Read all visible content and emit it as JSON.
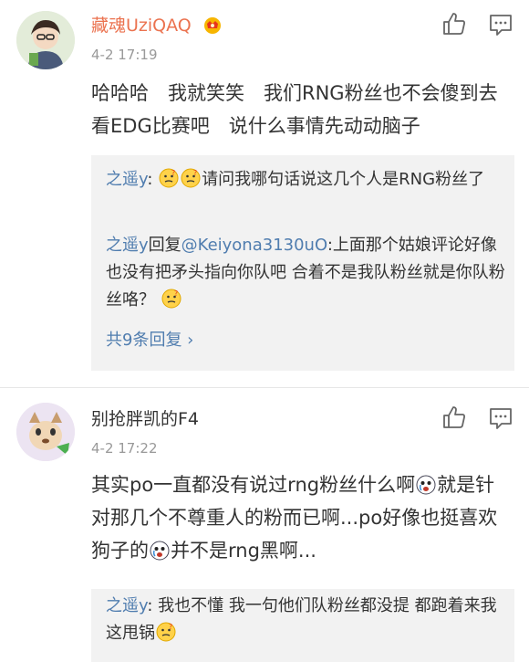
{
  "comments": [
    {
      "username": "藏魂UziQAQ",
      "time": "4-2 17:19",
      "text": "哈哈哈　我就笑笑　我们RNG粉丝也不会傻到去看EDG比赛吧　说什么事情先动动脑子",
      "replies": [
        {
          "user": "之遥y",
          "sep": ":",
          "text": "请问我哪句话说这几个人是RNG粉丝了"
        },
        {
          "user": "之遥y",
          "reply_word": "回复",
          "mention": "@Keiyona3130uO",
          "sep": ":",
          "text": "上面那个姑娘评论好像也没有把矛头指向你队吧 合着不是我队粉丝就是你队粉丝咯？"
        }
      ],
      "view_more": "共9条回复 ›"
    },
    {
      "username": "别抢胖凯的F4",
      "time": "4-2 17:22",
      "text_a": "其实po一直都没有说过rng粉丝什么啊",
      "text_b": "就是针对那几个不尊重人的粉而已啊...po好像也挺喜欢狗子的",
      "text_c": "并不是rng黑啊...",
      "replies": [
        {
          "user": "之遥y",
          "sep": ":",
          "text": "我也不懂 我一句他们队粉丝都没提 都跑着来我这甩锅"
        }
      ]
    }
  ],
  "icons": {
    "like": "thumbs-up-icon",
    "reply": "comment-icon",
    "badge": "vip-crown-icon",
    "emoji_think": "thinking-emoji",
    "emoji_cry": "crying-emoji"
  },
  "colors": {
    "username_vip": "#eb7350",
    "link_blue": "#507daf",
    "meta_gray": "#999999",
    "reply_bg": "#f2f2f2"
  }
}
